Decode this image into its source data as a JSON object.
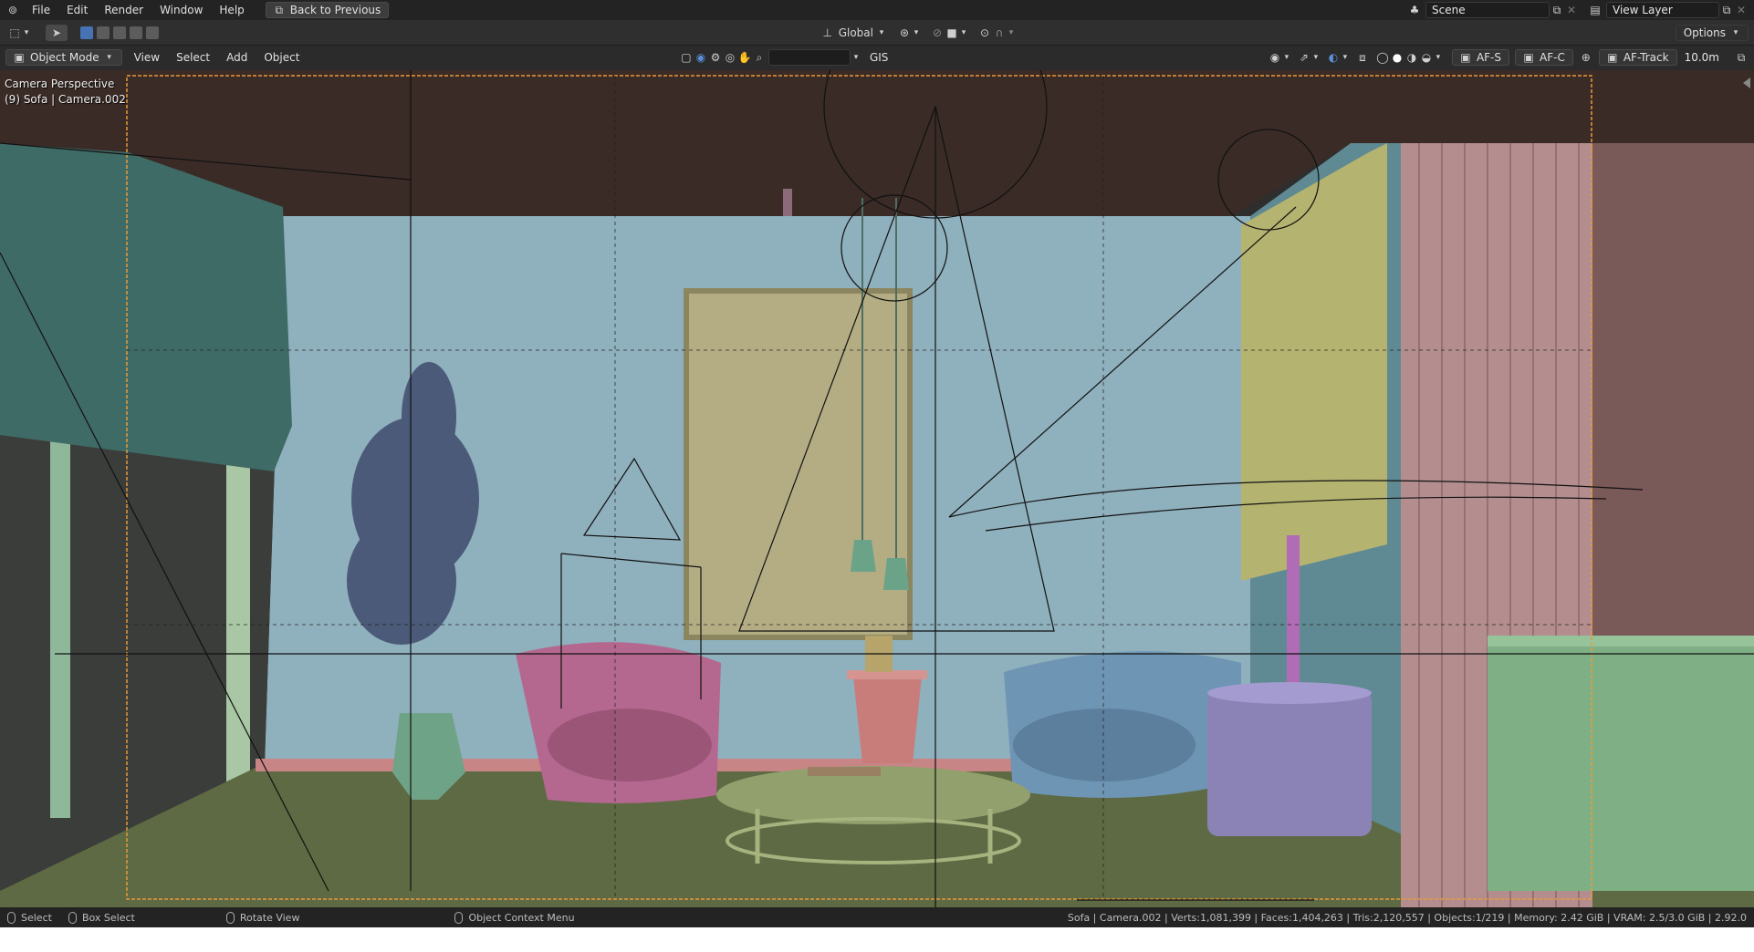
{
  "menubar": {
    "items": [
      "File",
      "Edit",
      "Render",
      "Window",
      "Help"
    ],
    "back_button": "Back to Previous",
    "scene": "Scene",
    "view_layer": "View Layer"
  },
  "header": {
    "transform_orientation": "Global",
    "options": "Options"
  },
  "viewport_header": {
    "mode": "Object Mode",
    "menus": [
      "View",
      "Select",
      "Add",
      "Object"
    ],
    "gis": "GIS",
    "af_s": "AF-S",
    "af_c": "AF-C",
    "af_track": "AF-Track",
    "distance": "10.0m"
  },
  "viewport": {
    "perspective": "Camera Perspective",
    "object_info": "(9) Sofa | Camera.002"
  },
  "statusbar": {
    "select": "Select",
    "box_select": "Box Select",
    "rotate_view": "Rotate View",
    "context_menu": "Object Context Menu",
    "stats": "Sofa | Camera.002 | Verts:1,081,399 | Faces:1,404,263 | Tris:2,120,557 | Objects:1/219 | Memory: 2.42 GiB | VRAM: 2.5/3.0 GiB | 2.92.0"
  },
  "colors": {
    "wall": "#8fb0bd",
    "ceiling": "#3a2b26",
    "floor": "#5e6a43",
    "armchair_left": "#b4688f",
    "armchair_right": "#6e95b4",
    "side_table": "#8b83b5",
    "picture_frame": "#b4ad84",
    "curtain_right": "#b48e8e",
    "camera_border": "#e79a3a"
  }
}
